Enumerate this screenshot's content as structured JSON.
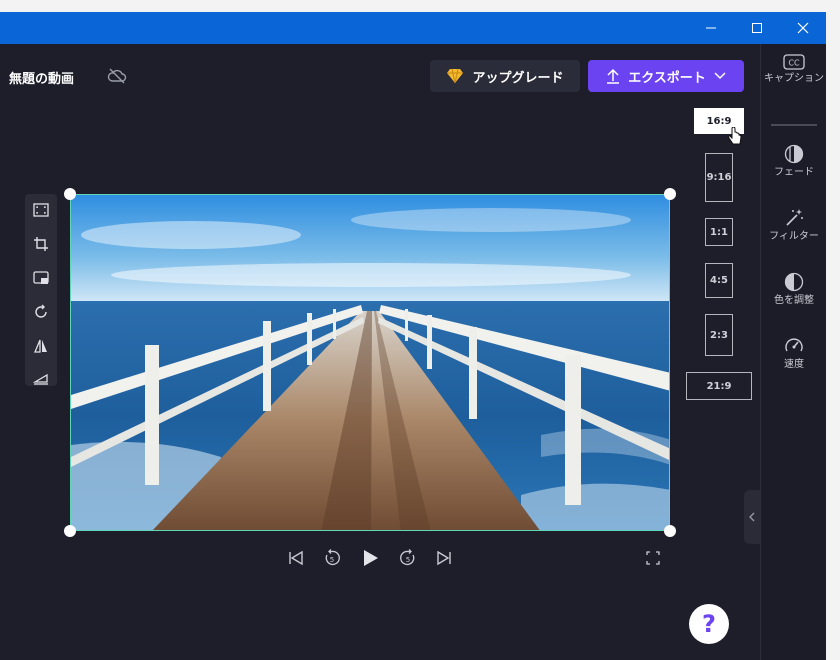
{
  "window": {
    "controls": [
      "minimize",
      "maximize",
      "close"
    ]
  },
  "header": {
    "title": "無題の動画",
    "cloud_status_icon": "cloud-off-icon",
    "upgrade_label": "アップグレード",
    "export_label": "エクスポート"
  },
  "colors": {
    "titlebar": "#0a66d6",
    "export": "#6b43f0",
    "selection": "#5fd6b5",
    "background": "#1d1e2a"
  },
  "aspect_ratios": {
    "items": [
      "16:9",
      "9:16",
      "1:1",
      "4:5",
      "2:3",
      "21:9"
    ],
    "selected": "16:9"
  },
  "sidebar": {
    "items": [
      {
        "label": "キャプション",
        "icon": "cc-icon"
      },
      {
        "label": "フェード",
        "icon": "fade-icon"
      },
      {
        "label": "フィルター",
        "icon": "magic-wand-icon"
      },
      {
        "label": "色を調整",
        "icon": "contrast-icon"
      },
      {
        "label": "速度",
        "icon": "speedometer-icon"
      }
    ]
  },
  "tools": [
    "fit-icon",
    "crop-icon",
    "picture-in-picture-icon",
    "rotate-icon",
    "flip-icon",
    "align-icon"
  ],
  "playback": {
    "controls": [
      "skip-back-icon",
      "rewind-5-icon",
      "play-icon",
      "forward-5-icon",
      "skip-forward-icon",
      "fullscreen-icon"
    ],
    "seek_seconds": "5"
  },
  "help_label": "?"
}
